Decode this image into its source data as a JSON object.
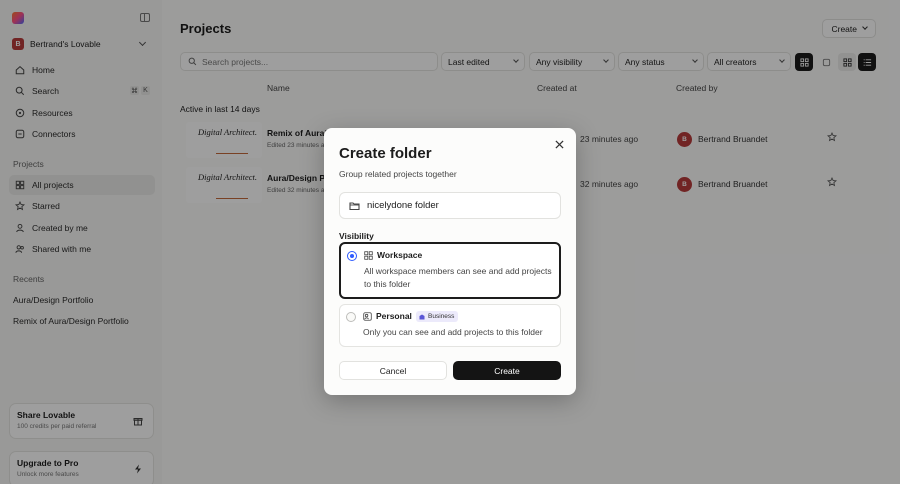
{
  "sidebar": {
    "workspace": {
      "avatar_letter": "B",
      "name": "Bertrand's Lovable"
    },
    "nav": [
      {
        "label": "Home",
        "icon": "home-icon"
      },
      {
        "label": "Search",
        "icon": "search-icon",
        "shortcut": [
          "⌘",
          "K"
        ]
      },
      {
        "label": "Resources",
        "icon": "compass-icon"
      },
      {
        "label": "Connectors",
        "icon": "link-icon"
      }
    ],
    "projects_label": "Projects",
    "projects_nav": [
      {
        "label": "All projects",
        "icon": "grid-icon",
        "active": true
      },
      {
        "label": "Starred",
        "icon": "star-icon"
      },
      {
        "label": "Created by me",
        "icon": "user-icon"
      },
      {
        "label": "Shared with me",
        "icon": "users-icon"
      }
    ],
    "recents_label": "Recents",
    "recents": [
      "Aura/Design Portfolio",
      "Remix of Aura/Design Portfolio"
    ],
    "share": {
      "title": "Share Lovable",
      "subtitle": "100 credits per paid referral"
    },
    "upgrade": {
      "title": "Upgrade to Pro",
      "subtitle": "Unlock more features"
    }
  },
  "main": {
    "title": "Projects",
    "create_label": "Create",
    "search_placeholder": "Search projects...",
    "filters": [
      "Last edited",
      "Any visibility",
      "Any status",
      "All creators"
    ],
    "columns": [
      "Name",
      "Created at",
      "Created by"
    ],
    "group_label": "Active in last 14 days",
    "rows": [
      {
        "name": "Remix of Aura/Design Portfolio",
        "edited": "Edited 23 minutes ago",
        "created": "23 minutes ago",
        "creator_initial": "B",
        "creator": "Bertrand Bruandet",
        "thumb": "Digital Architect."
      },
      {
        "name": "Aura/Design Portfolio",
        "edited": "Edited 32 minutes ago",
        "created": "32 minutes ago",
        "creator_initial": "B",
        "creator": "Bertrand Bruandet",
        "thumb": "Digital Architect."
      }
    ]
  },
  "modal": {
    "title": "Create folder",
    "subtitle": "Group related projects together",
    "folder_name": "nicelydone folder",
    "visibility_label": "Visibility",
    "options": [
      {
        "title": "Workspace",
        "description": "All workspace members can see and add projects to this folder",
        "selected": true
      },
      {
        "title": "Personal",
        "badge": "Business",
        "description": "Only you can see and add projects to this folder",
        "selected": false
      }
    ],
    "cancel_label": "Cancel",
    "create_label": "Create"
  },
  "colors": {
    "accent": "#2e5bff",
    "avatar": "#b73a3a",
    "primary_button": "#141414"
  }
}
